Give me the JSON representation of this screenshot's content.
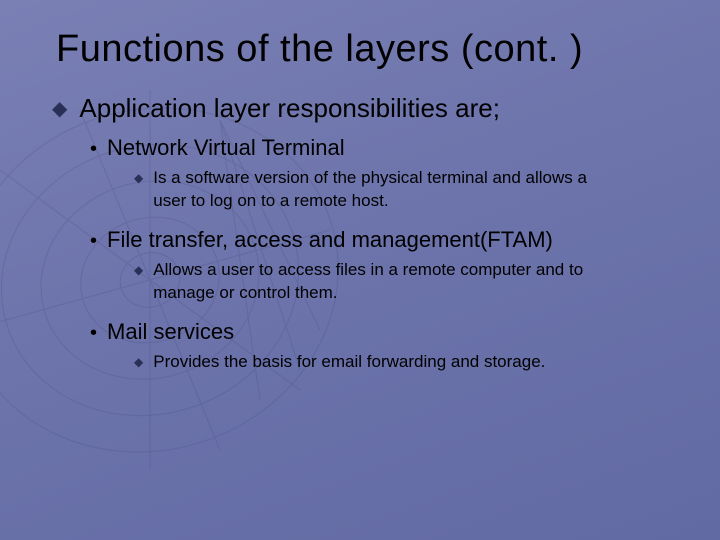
{
  "title": "Functions of the layers (cont. )",
  "lvl1": {
    "text": "Application layer responsibilities are;"
  },
  "items": [
    {
      "heading": "Network Virtual Terminal",
      "detail": "Is a software version of the physical terminal and allows a user to log on to a remote host."
    },
    {
      "heading": "File transfer, access and management(FTAM)",
      "detail": "Allows a user to access files in a remote computer and to manage or control them."
    },
    {
      "heading": "Mail services",
      "detail": "Provides the basis for email forwarding and storage."
    }
  ]
}
